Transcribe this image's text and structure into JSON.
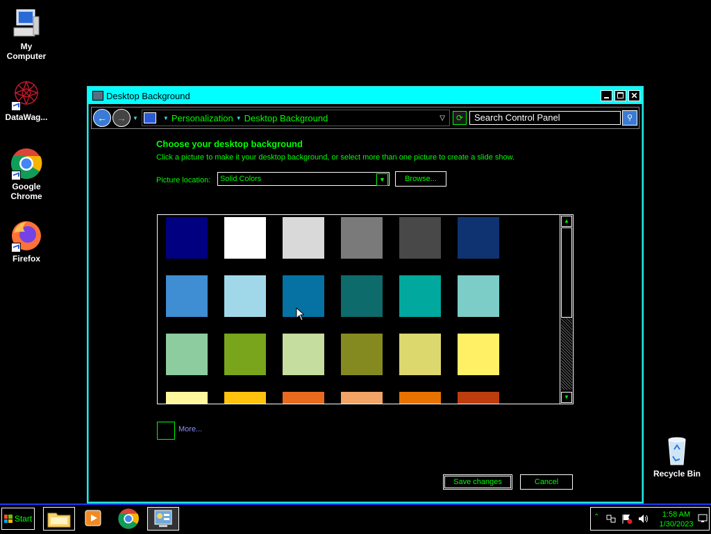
{
  "desktop": {
    "icons": [
      {
        "label": "My Computer"
      },
      {
        "label": "DataWag..."
      },
      {
        "label": "Google Chrome"
      },
      {
        "label": "Firefox"
      },
      {
        "label": "Recycle Bin"
      }
    ]
  },
  "window": {
    "title": "Desktop Background",
    "address": {
      "crumbs": [
        "Personalization",
        "Desktop Background"
      ]
    },
    "search_placeholder": "Search Control Panel",
    "heading": "Choose your desktop background",
    "subtext": "Click a picture to make it your desktop background, or select more than one picture to create a slide show.",
    "picture_location_label": "Picture location:",
    "picture_location_value": "Solid Colors",
    "browse_label": "Browse...",
    "more_label": "More...",
    "save_label": "Save changes",
    "cancel_label": "Cancel",
    "swatches": [
      [
        "#000080",
        "#ffffff",
        "#d9d9d9",
        "#7a7a7a",
        "#484848",
        "#0e3370"
      ],
      [
        "#3f8dd3",
        "#a0d8ea",
        "#0572a3",
        "#0d6b6b",
        "#00a89d",
        "#7ccdc8"
      ],
      [
        "#8dcc9e",
        "#78a51b",
        "#c5dd9e",
        "#858a20",
        "#ddd86e",
        "#fff066"
      ],
      [
        "#fff79e",
        "#ffc20d",
        "#e86a1e",
        "#f2a466",
        "#e87200",
        "#bd3d0e"
      ]
    ]
  },
  "taskbar": {
    "start_label": "Start",
    "clock_time": "1:58 AM",
    "clock_date": "1/30/2023"
  }
}
